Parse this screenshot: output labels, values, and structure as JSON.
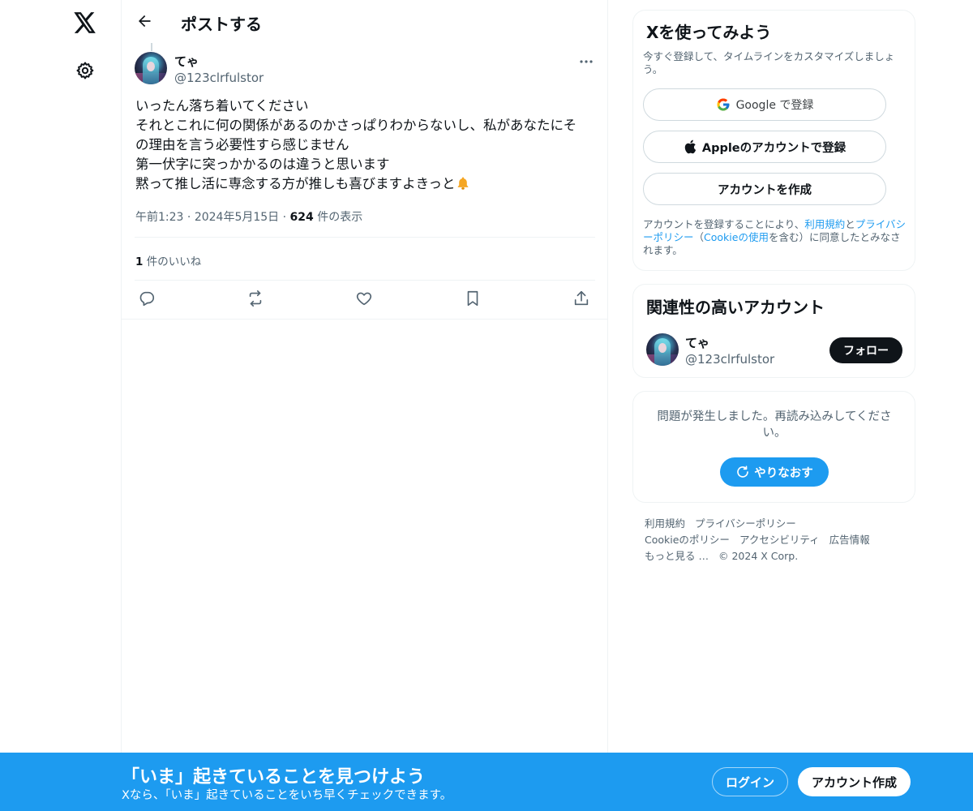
{
  "nav": {
    "logo_icon": "x-logo-icon",
    "settings_icon": "gear-icon"
  },
  "header": {
    "back_icon": "arrow-left-icon",
    "title": "ポストする"
  },
  "post": {
    "author_name": "てゃ",
    "author_handle": "@123clrfulstor",
    "body_lines": [
      "いったん落ち着いてください",
      "それとこれに何の関係があるのかさっぱりわからないし、私があなたにそ",
      "の理由を言う必要性すら感じません",
      "第一伏字に突っかかるのは違うと思います",
      "黙って推し活に専念する方が推しも喜びますよきっと"
    ],
    "body_emoji": "bell-icon",
    "time": "午前1:23",
    "sep": "·",
    "date": "2024年5月15日",
    "views_count": "624",
    "views_label": " 件の表示",
    "likes_count": "1",
    "likes_label": " 件のいいね"
  },
  "signup": {
    "title": "Xを使ってみよう",
    "subtitle": "今すぐ登録して、タイムラインをカスタマイズしましょう。",
    "google_label": "Google で登録",
    "apple_label": "Appleのアカウントで登録",
    "create_label": "アカウントを作成",
    "legal_prefix": "アカウントを登録することにより、",
    "legal_terms": "利用規約",
    "legal_and": "と",
    "legal_privacy": "プライバシーポリシー",
    "legal_paren_open": "（",
    "legal_cookie": "Cookieの使用",
    "legal_suffix": "を含む）に同意したとみなされます。"
  },
  "related": {
    "title": "関連性の高いアカウント",
    "name": "てゃ",
    "handle": "@123clrfulstor",
    "follow_label": "フォロー"
  },
  "error": {
    "message": "問題が発生しました。再読み込みしてください。",
    "retry_label": "やりなおす"
  },
  "footer": {
    "links": [
      "利用規約",
      "プライバシーポリシー",
      "Cookieのポリシー",
      "アクセシビリティ",
      "広告情報",
      "もっと見る …",
      "© 2024 X Corp."
    ]
  },
  "bottombar": {
    "title": "「いま」起きていることを見つけよう",
    "subtitle": "Xなら、「いま」起きていることをいち早くチェックできます。",
    "login_label": "ログイン",
    "create_label": "アカウント作成"
  },
  "colors": {
    "accent": "#1d9bf0",
    "text": "#0f1419",
    "muted": "#536471",
    "border": "#eff3f4"
  }
}
